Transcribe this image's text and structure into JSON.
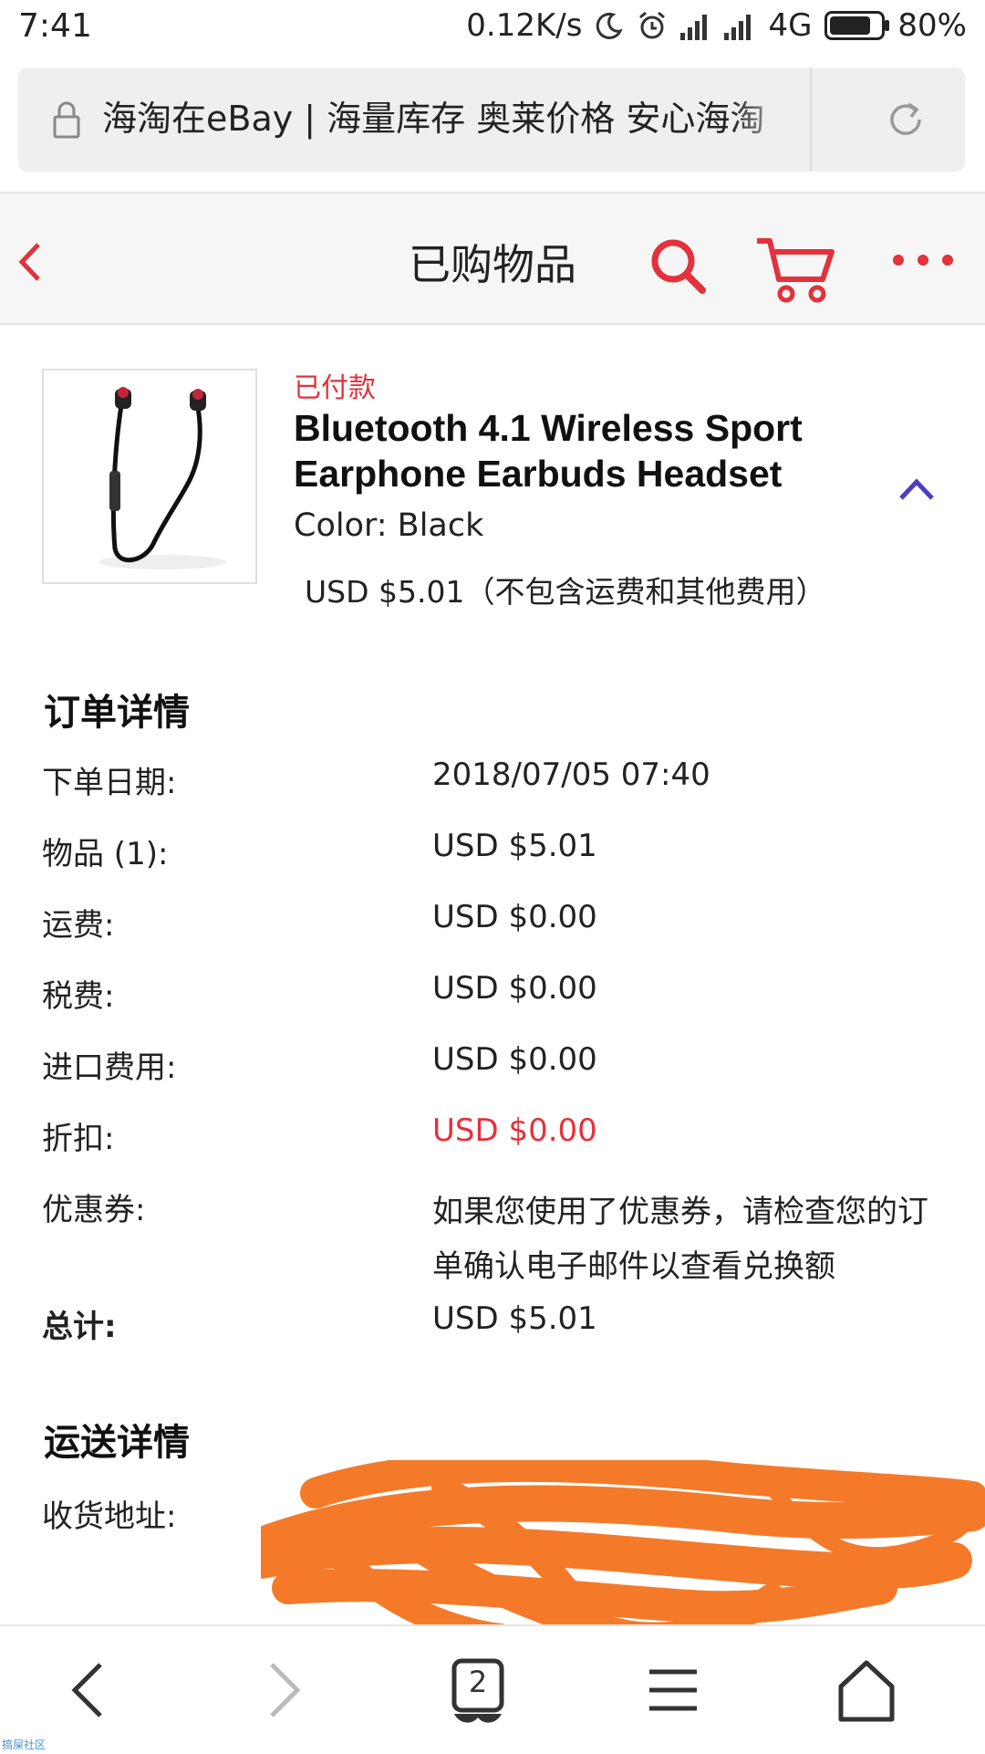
{
  "status_bar": {
    "time": "7:41",
    "net_speed": "0.12K/s",
    "network": "4G",
    "battery": "80%"
  },
  "browser": {
    "url_title": "海淘在eBay | 海量库存 奥莱价格 安心海淘"
  },
  "header": {
    "title": "已购物品"
  },
  "product": {
    "status": "已付款",
    "title": "Bluetooth 4.1 Wireless Sport Earphone Earbuds Headset",
    "color": "Color: Black",
    "price": "USD $5.01（不包含运费和其他费用）"
  },
  "order_details": {
    "heading": "订单详情",
    "rows": [
      {
        "label": "下单日期:",
        "value": "2018/07/05 07:40"
      },
      {
        "label": "物品 (1):",
        "value": "USD $5.01"
      },
      {
        "label": "运费:",
        "value": "USD $0.00"
      },
      {
        "label": "税费:",
        "value": "USD $0.00"
      },
      {
        "label": "进口费用:",
        "value": "USD $0.00"
      },
      {
        "label": "折扣:",
        "value": "USD $0.00"
      },
      {
        "label": "优惠券:",
        "value": "如果您使用了优惠券，请检查您的订单确认电子邮件以查看兑换额"
      },
      {
        "label": "总计:",
        "value": "USD $5.01"
      }
    ]
  },
  "shipping_details": {
    "heading": "运送详情",
    "address_label": "收货地址:"
  },
  "bottom_nav": {
    "tab_count": "2"
  },
  "watermark": "搞屎社区",
  "colors": {
    "accent_red": "#e2323b",
    "collapse_arrow": "#4b3cc9",
    "redaction_orange": "#f47a2a"
  }
}
